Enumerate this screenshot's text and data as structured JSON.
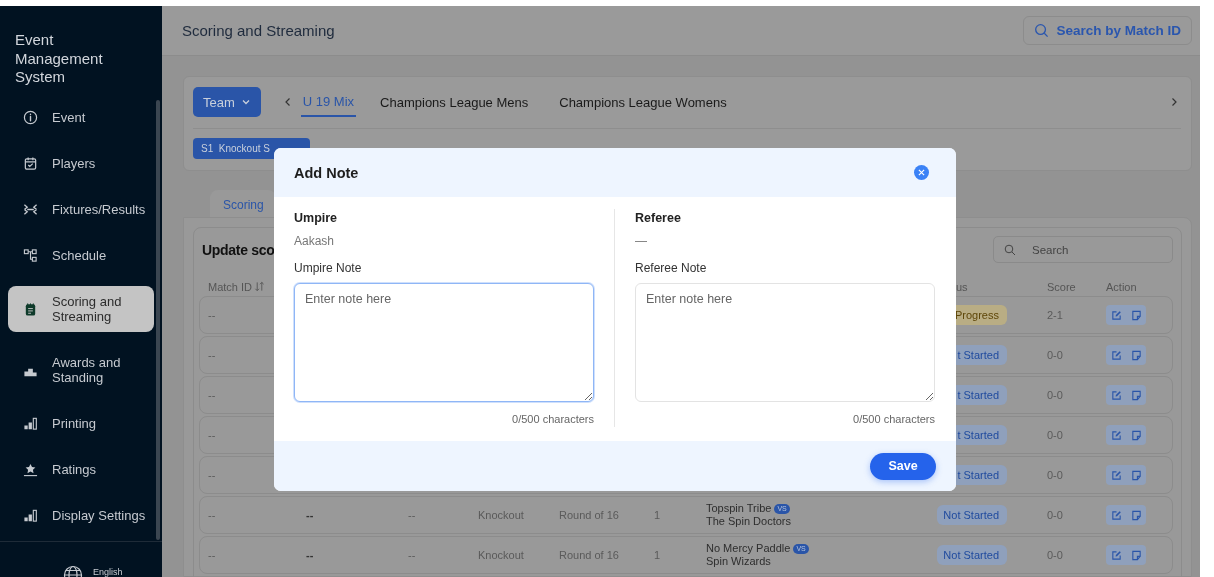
{
  "sidebar": {
    "title": "Event Management System",
    "items": [
      {
        "label": "Event",
        "selected": false
      },
      {
        "label": "Players",
        "selected": false
      },
      {
        "label": "Fixtures/Results",
        "selected": false
      },
      {
        "label": "Schedule",
        "selected": false
      },
      {
        "label": "Scoring and Streaming",
        "selected": true
      },
      {
        "label": "Awards and Standing",
        "selected": false
      },
      {
        "label": "Printing",
        "selected": false
      },
      {
        "label": "Ratings",
        "selected": false
      },
      {
        "label": "Display Settings",
        "selected": false
      }
    ],
    "language": "English"
  },
  "header": {
    "title": "Scoring and Streaming",
    "search_button": "Search by Match ID"
  },
  "filters": {
    "team_button": "Team",
    "tabs": [
      {
        "label": "U 19 Mix",
        "selected": true
      },
      {
        "label": "Champions League Mens",
        "selected": false
      },
      {
        "label": "Champions League Womens",
        "selected": false
      }
    ],
    "stage_chip": "S1  Knockout S"
  },
  "section_tabs": [
    {
      "label": "Scoring",
      "selected": true
    }
  ],
  "table": {
    "title": "Update sco",
    "search": {
      "placeholder": "Search"
    },
    "columns": [
      {
        "label": "Match ID",
        "sortable": true
      },
      {
        "label": "us",
        "sortable": false
      },
      {
        "label": "Score",
        "sortable": false
      },
      {
        "label": "Action",
        "sortable": false
      }
    ],
    "rows": [
      {
        "match_id": "--",
        "status": {
          "text": "Progress",
          "kind": "in_progress"
        },
        "score": "2-1"
      },
      {
        "match_id": "--",
        "status": {
          "text": "t Started",
          "kind": "not_started"
        },
        "score": "0-0"
      },
      {
        "match_id": "--",
        "status": {
          "text": "t Started",
          "kind": "not_started"
        },
        "score": "0-0"
      },
      {
        "match_id": "--",
        "status": {
          "text": "t Started",
          "kind": "not_started"
        },
        "score": "0-0"
      },
      {
        "match_id": "--",
        "status": {
          "text": "t Started",
          "kind": "not_started"
        },
        "score": "0-0"
      },
      {
        "match_id": "--",
        "column_2": "--",
        "column_3": "--",
        "type": "Knockout",
        "round": "Round of 16",
        "column_6": "1",
        "team_1": "Topspin Tribe",
        "vs": "VS",
        "team_2": "The Spin Doctors",
        "status": {
          "text": "Not Started",
          "kind": "not_started"
        },
        "score": "0-0"
      },
      {
        "match_id": "--",
        "column_2": "--",
        "column_3": "--",
        "type": "Knockout",
        "round": "Round of 16",
        "column_6": "1",
        "team_1": "No Mercy Paddle",
        "vs": "VS",
        "team_2": "Spin Wizards",
        "status": {
          "text": "Not Started",
          "kind": "not_started"
        },
        "score": "0-0"
      }
    ]
  },
  "modal": {
    "title": "Add Note",
    "columns": [
      {
        "role": "Umpire",
        "name": "Aakash",
        "note_label": "Umpire Note",
        "placeholder": "Enter note here",
        "counter": "0/500 characters",
        "focused": true
      },
      {
        "role": "Referee",
        "name": "—",
        "note_label": "Referee Note",
        "placeholder": "Enter note here",
        "counter": "0/500 characters",
        "focused": false
      }
    ],
    "save_button": "Save"
  }
}
